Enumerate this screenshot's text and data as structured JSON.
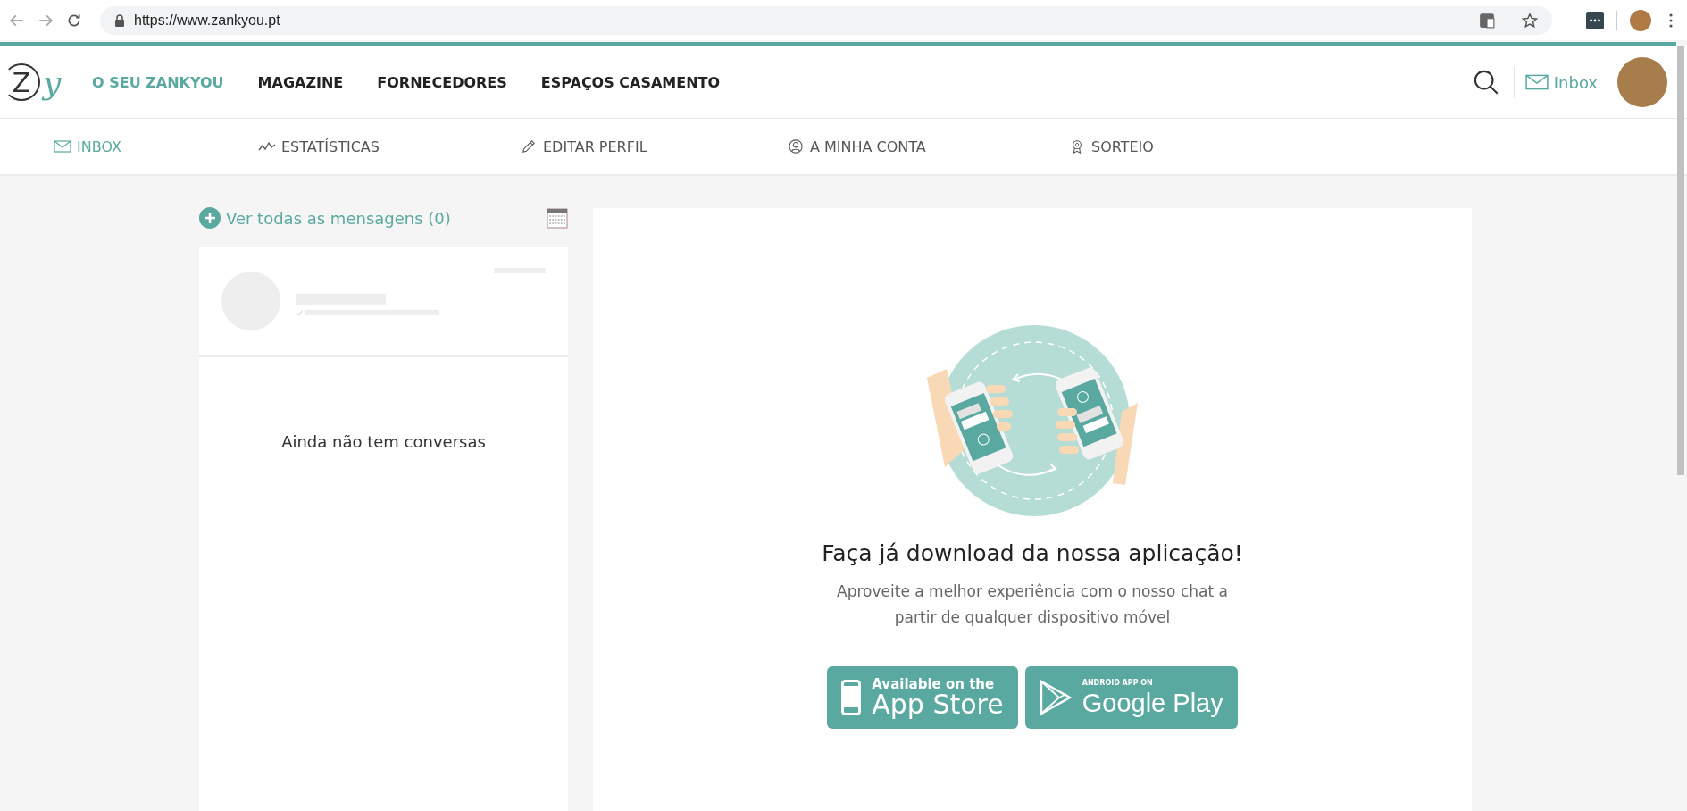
{
  "browser": {
    "url": "https://www.zankyou.pt"
  },
  "header": {
    "logo": {
      "mark": "Z",
      "script": "y"
    },
    "nav": [
      {
        "label": "O SEU ZANKYOU",
        "selected": true
      },
      {
        "label": "MAGAZINE",
        "selected": false
      },
      {
        "label": "FORNECEDORES",
        "selected": false
      },
      {
        "label": "ESPAÇOS CASAMENTO",
        "selected": false
      }
    ],
    "inbox_link": "Inbox"
  },
  "subnav": [
    {
      "label": "INBOX",
      "kind": "envelope",
      "selected": true
    },
    {
      "label": "ESTATÍSTICAS",
      "kind": "stats",
      "selected": false
    },
    {
      "label": "EDITAR PERFIL",
      "kind": "pencil",
      "selected": false
    },
    {
      "label": "A MINHA CONTA",
      "kind": "account",
      "selected": false
    },
    {
      "label": "SORTEIO",
      "kind": "award",
      "selected": false
    }
  ],
  "messages": {
    "view_all": "Ver todas as mensagens (0)",
    "empty_text": "Ainda não tem conversas"
  },
  "promo": {
    "title": "Faça já download da nossa aplicação!",
    "description": "Aproveite a melhor experiência com o nosso chat a partir de qualquer dispositivo móvel",
    "stores": [
      {
        "kind": "apple",
        "small": "Available on the",
        "large": "App Store"
      },
      {
        "kind": "google",
        "small": "ANDROID APP ON",
        "large": "Google Play"
      }
    ]
  }
}
